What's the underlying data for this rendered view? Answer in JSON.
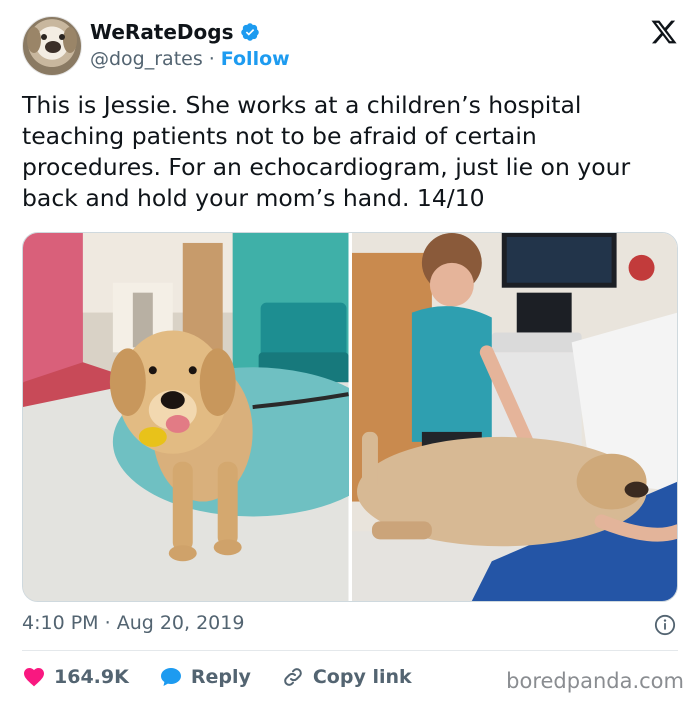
{
  "tweet": {
    "display_name": "WeRateDogs",
    "handle": "@dog_rates",
    "separator": "·",
    "follow_label": "Follow",
    "text": "This is Jessie. She works at a children’s hospital teaching patients not to be afraid of certain procedures. For an echocardiogram, just lie on your back and hold your mom’s hand. 14/10",
    "time": "4:10 PM",
    "date_separator": "·",
    "date": "Aug 20, 2019"
  },
  "actions": {
    "likes": "164.9K",
    "reply_label": "Reply",
    "copy_link_label": "Copy link"
  },
  "watermark": "boredpanda.com",
  "icons": {
    "verified": "verified-badge-icon",
    "x_logo": "x-logo-icon",
    "info": "info-icon",
    "like": "heart-icon",
    "reply": "speech-bubble-icon",
    "copy": "link-icon"
  },
  "colors": {
    "accent": "#1d9bf0",
    "like": "#f91880",
    "text": "#0f1419",
    "muted": "#536471"
  }
}
